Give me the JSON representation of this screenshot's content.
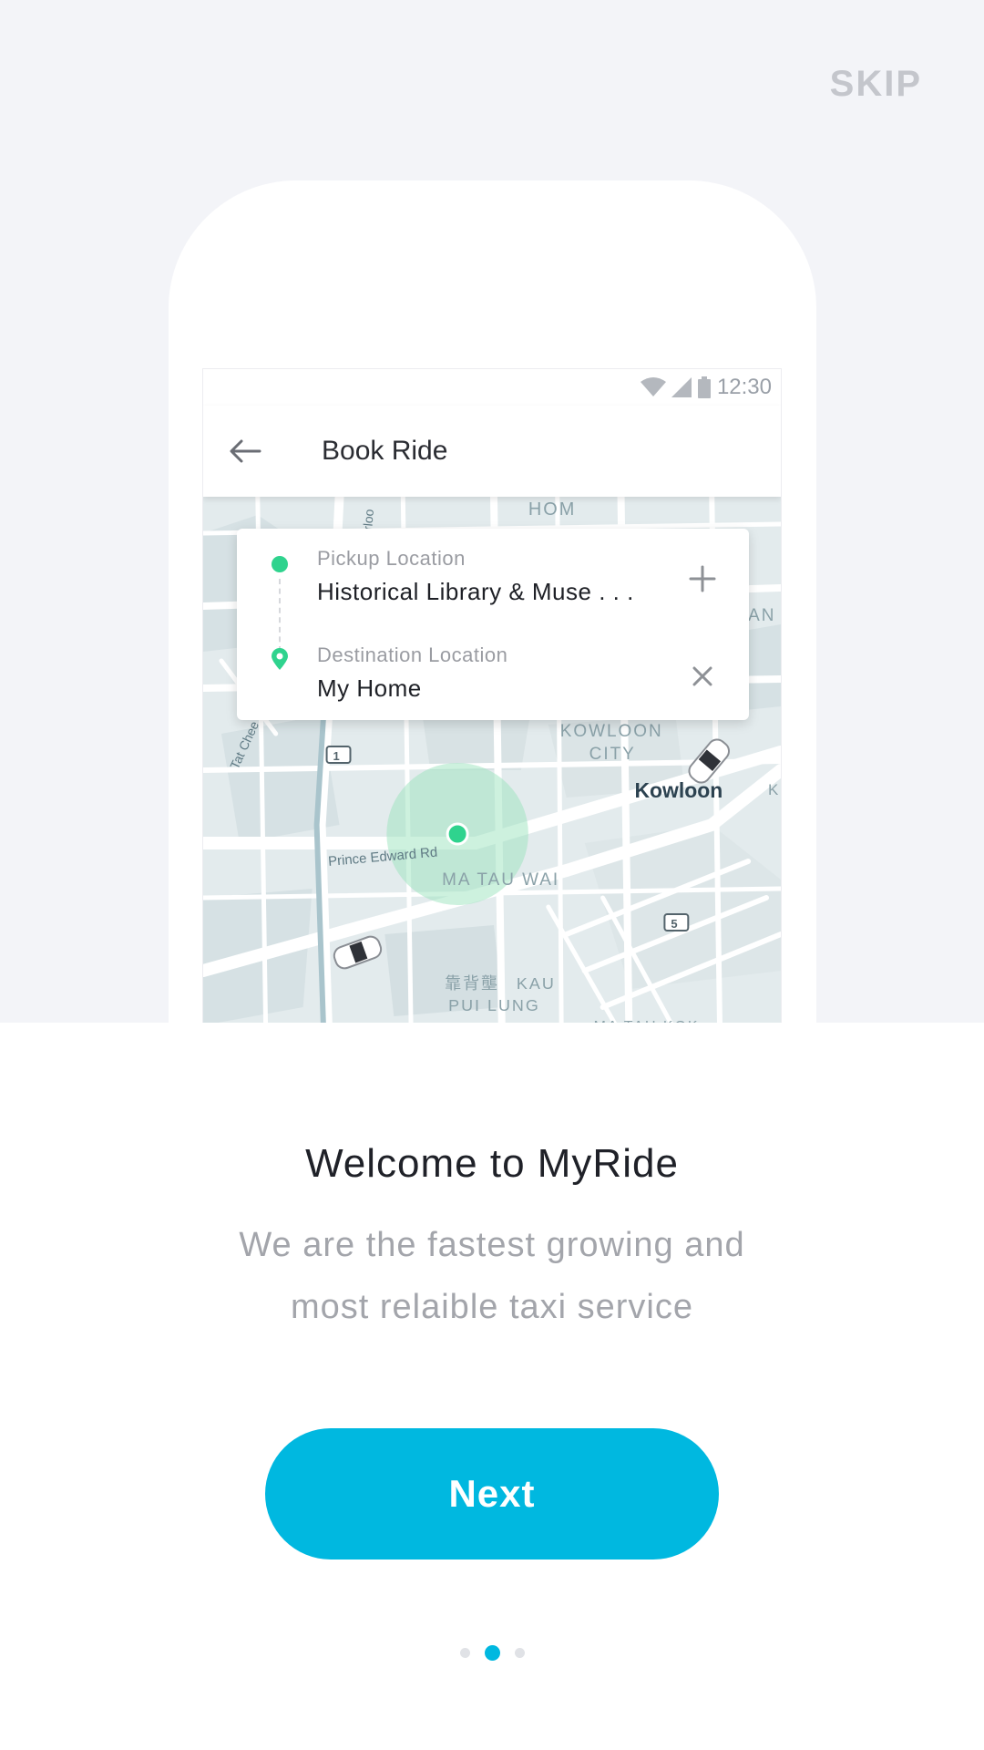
{
  "skip_label": "SKIP",
  "phone": {
    "status_time": "12:30",
    "appbar_title": "Book Ride",
    "pickup": {
      "label": "Pickup Location",
      "value": "Historical Library & Muse . . ."
    },
    "destination": {
      "label": "Destination Location",
      "value": "My Home"
    },
    "map_labels": {
      "hom": "HOM",
      "kowloon_city_1": "KOWLOON",
      "kowloon_city_2": "CITY",
      "kowloon": "Kowloon",
      "prince_edward": "Prince Edward Rd",
      "ma_tau_wai": "MA TAU WAI",
      "kau_pui_lung_cn": "靠背壟",
      "kau": "KAU",
      "pui_lung": "PUI LUNG",
      "ma_tau_kok": "MA TAU KOK",
      "tat_chee": "Tat Chee",
      "route_1": "1",
      "route_5": "5",
      "an": "AN",
      "k": "K",
      "erloo": "erloo"
    }
  },
  "onboarding": {
    "title": "Welcome to MyRide",
    "subtitle_line1": "We are the fastest growing and",
    "subtitle_line2": "most relaible taxi service",
    "next_label": "Next",
    "page_count": 3,
    "active_page": 2
  },
  "colors": {
    "accent": "#00b8e0",
    "pickup_green": "#2fd38e",
    "background": "#f3f4f8"
  }
}
